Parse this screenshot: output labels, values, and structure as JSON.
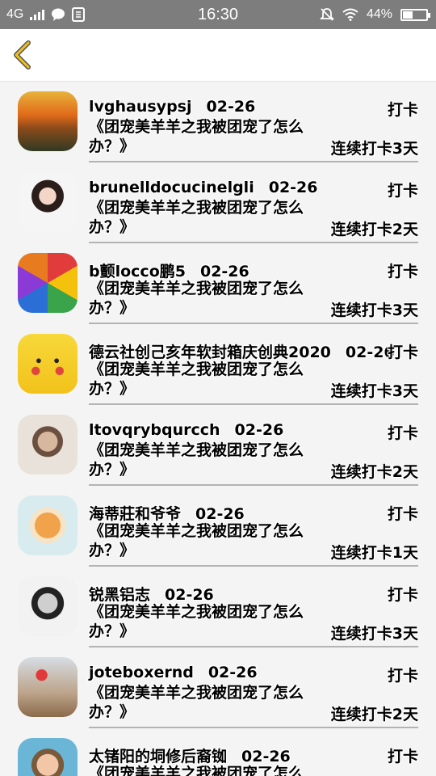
{
  "status_bar": {
    "network": "4G",
    "time": "16:30",
    "battery": "44%",
    "battery_level": 0.44
  },
  "items": [
    {
      "name": "lvghausypsj",
      "date": "02-26",
      "action": "打卡",
      "title": "《团宠美羊羊之我被团宠了怎么办？》",
      "streak": "连续打卡3天",
      "avatar": "sunset-landscape"
    },
    {
      "name": "brunelldocucinelgli",
      "date": "02-26",
      "action": "打卡",
      "title": "《团宠美羊羊之我被团宠了怎么办？》",
      "streak": "连续打卡2天",
      "avatar": "girl-portrait"
    },
    {
      "name": "b颤locco鹏5",
      "date": "02-26",
      "action": "打卡",
      "title": "《团宠美羊羊之我被团宠了怎么办？》",
      "streak": "连续打卡3天",
      "avatar": "pinwheel"
    },
    {
      "name": "德云社创己亥年软封箱庆创典2020",
      "date": "02-26",
      "action": "打卡",
      "title": "《团宠美羊羊之我被团宠了怎么办？》",
      "streak": "连续打卡3天",
      "avatar": "pikachu"
    },
    {
      "name": "ltovqrybqurcch",
      "date": "02-26",
      "action": "打卡",
      "title": "《团宠美羊羊之我被团宠了怎么办？》",
      "streak": "连续打卡2天",
      "avatar": "girl-hugging-knees"
    },
    {
      "name": "海蒂莊和爷爷",
      "date": "02-26",
      "action": "打卡",
      "title": "《团宠美羊羊之我被团宠了怎么办？》",
      "streak": "连续打卡1天",
      "avatar": "kitten"
    },
    {
      "name": "锐黑铝志",
      "date": "02-26",
      "action": "打卡",
      "title": "《团宠美羊羊之我被团宠了怎么办？》",
      "streak": "连续打卡3天",
      "avatar": "bw-girl"
    },
    {
      "name": "joteboxernd",
      "date": "02-26",
      "action": "打卡",
      "title": "《团宠美羊羊之我被团宠了怎么办？》",
      "streak": "连续打卡2天",
      "avatar": "flower-vase"
    },
    {
      "name": "太锗阳的垌修后裔铷",
      "date": "02-26",
      "action": "打卡",
      "title": "《团宠美羊羊之我被团宠了怎么办？》",
      "streak": "",
      "avatar": "girl-selfie"
    }
  ]
}
